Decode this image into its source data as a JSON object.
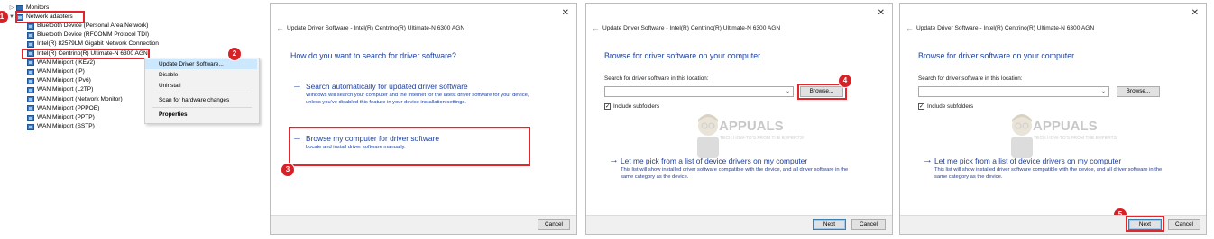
{
  "device_manager": {
    "monitors_label": "Monitors",
    "network_adapters_label": "Network adapters",
    "devices": [
      "Bluetooth Device (Personal Area Network)",
      "Bluetooth Device (RFCOMM Protocol TDI)",
      "Intel(R) 82579LM Gigabit Network Connection",
      "Intel(R) Centrino(R) Ultimate-N 6300 AGN",
      "WAN Miniport (IKEv2)",
      "WAN Miniport (IP)",
      "WAN Miniport (IPv6)",
      "WAN Miniport (L2TP)",
      "WAN Miniport (Network Monitor)",
      "WAN Miniport (PPPOE)",
      "WAN Miniport (PPTP)",
      "WAN Miniport (SSTP)"
    ],
    "context_menu": {
      "update": "Update Driver Software...",
      "disable": "Disable",
      "uninstall": "Uninstall",
      "scan": "Scan for hardware changes",
      "properties": "Properties"
    }
  },
  "steps": [
    "1",
    "2",
    "3",
    "4",
    "5"
  ],
  "dialog1": {
    "title": "Update Driver Software - Intel(R) Centrino(R) Ultimate-N 6300 AGN",
    "heading": "How do you want to search for driver software?",
    "option1_title": "Search automatically for updated driver software",
    "option1_desc": "Windows will search your computer and the Internet for the latest driver software for your device, unless you've disabled this feature in your device installation settings.",
    "option2_title": "Browse my computer for driver software",
    "option2_desc": "Locate and install driver software manually.",
    "cancel": "Cancel"
  },
  "dialog2": {
    "title": "Update Driver Software - Intel(R) Centrino(R) Ultimate-N 6300 AGN",
    "heading": "Browse for driver software on your computer",
    "search_label": "Search for driver software in this location:",
    "path_value": "",
    "browse": "Browse...",
    "include_subfolders": "Include subfolders",
    "pick_title": "Let me pick from a list of device drivers on my computer",
    "pick_desc": "This list will show installed driver software compatible with the device, and all driver software in the same category as the device.",
    "next": "Next",
    "cancel": "Cancel"
  },
  "dialog3": {
    "title": "Update Driver Software - Intel(R) Centrino(R) Ultimate-N 6300 AGN",
    "heading": "Browse for driver software on your computer",
    "search_label": "Search for driver software in this location:",
    "path_value": "",
    "browse": "Browse...",
    "include_subfolders": "Include subfolders",
    "pick_title": "Let me pick from a list of device drivers on my computer",
    "pick_desc": "This list will show installed driver software compatible with the device, and all driver software in the same category as the device.",
    "next": "Next",
    "cancel": "Cancel"
  },
  "watermark": {
    "brand": "APPUALS",
    "tagline": "TECH HOW-TO'S FROM THE EXPERTS!"
  },
  "icons": {
    "close": "close-icon",
    "back": "back-arrow-icon",
    "arrow": "arrow-right-icon",
    "checkbox": "checked"
  },
  "colors": {
    "link_blue": "#1c3f9c",
    "annotation_red": "#e2262c",
    "menu_highlight": "#cce8ff"
  }
}
